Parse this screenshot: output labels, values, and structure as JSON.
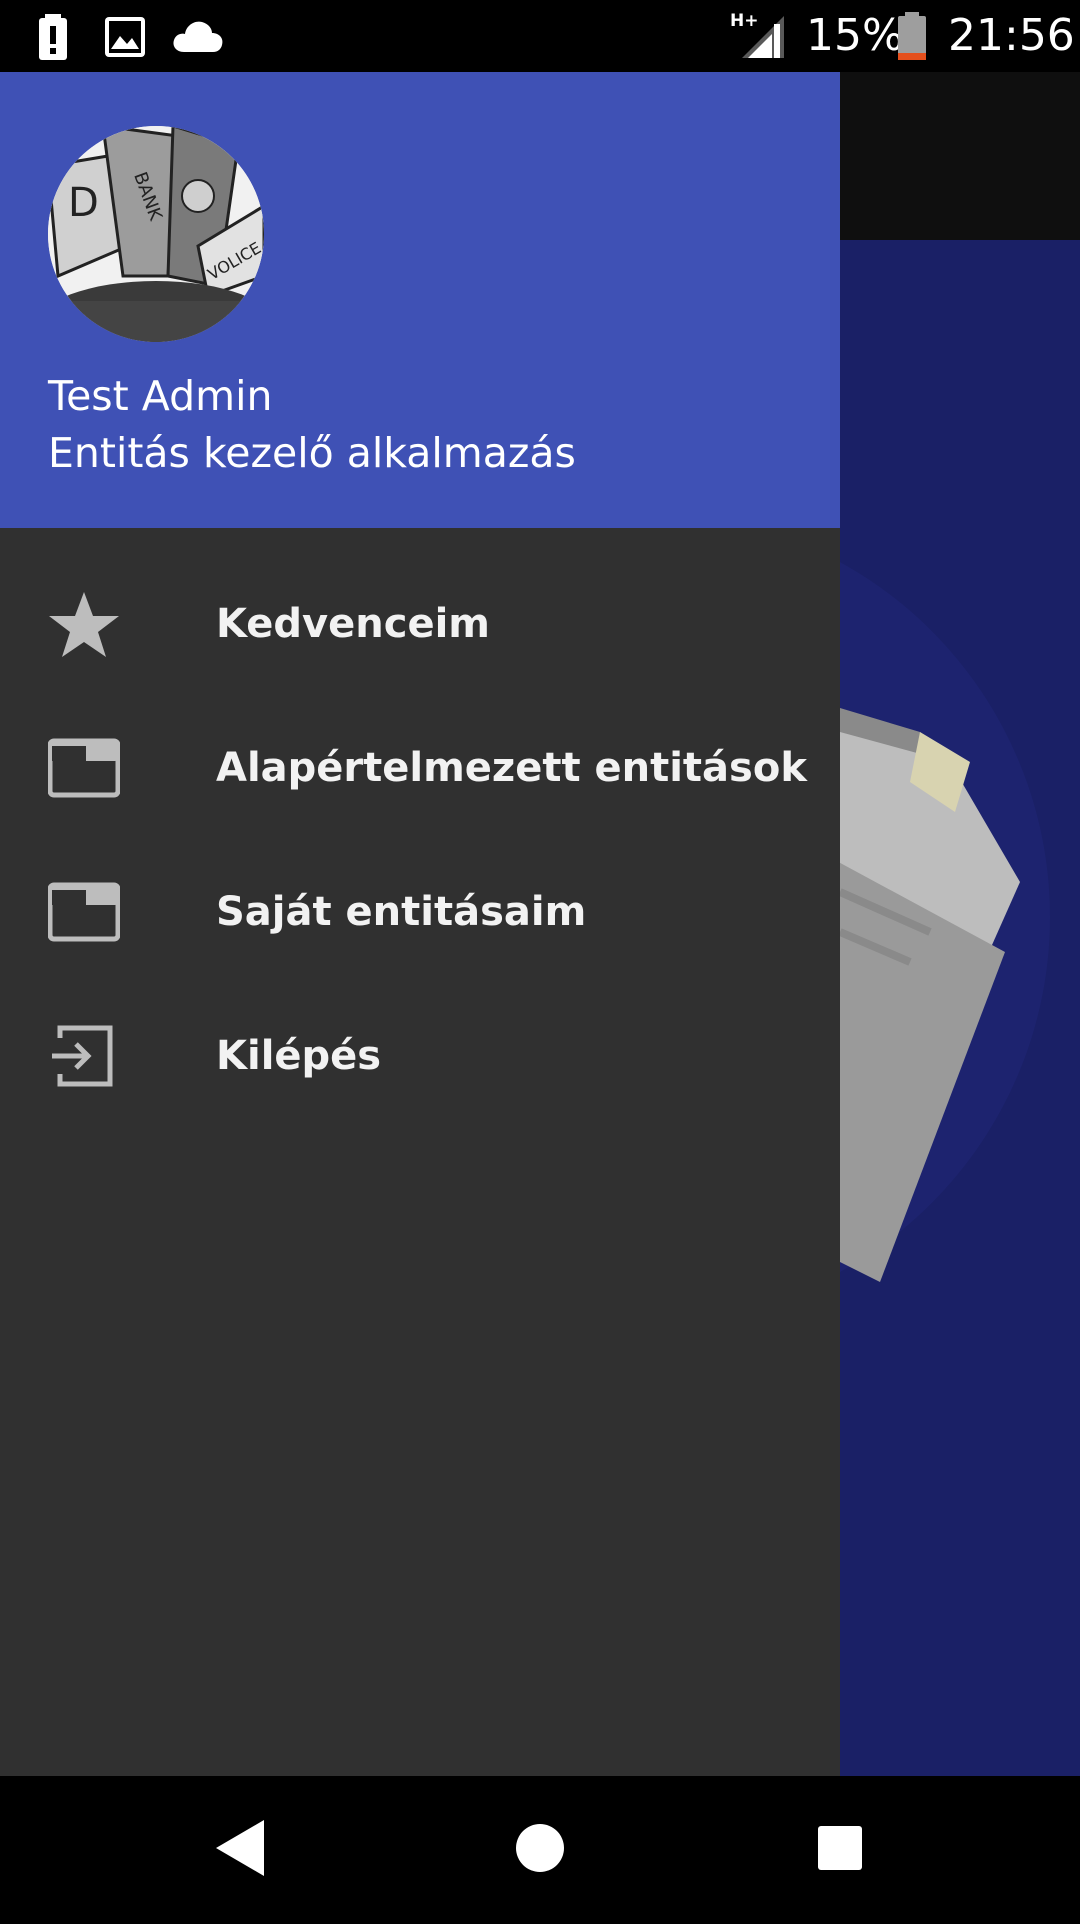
{
  "status_bar": {
    "network": "H+",
    "battery_percent": "15%",
    "time": "21:56",
    "battery_level": 0.15,
    "battery_color": "#e5501d",
    "left_icons": [
      "alert-icon",
      "image-icon",
      "cloud-icon"
    ]
  },
  "drawer": {
    "header_color": "#3f51b5",
    "user_name": "Test Admin",
    "app_subtitle": "Entitás kezelő alkalmazás",
    "menu": [
      {
        "label": "Kedvenceim",
        "icon": "star-icon"
      },
      {
        "label": "Alapértelmezett entitások",
        "icon": "folder-tab-icon"
      },
      {
        "label": "Saját entitásaim",
        "icon": "folder-tab-icon"
      },
      {
        "label": "Kilépés",
        "icon": "exit-icon"
      }
    ]
  },
  "background": {
    "toolbar_color": "#0f0f0f",
    "content_color": "#1a2066"
  },
  "nav_bar": {
    "buttons": [
      "back-icon",
      "home-icon",
      "recents-icon"
    ]
  }
}
